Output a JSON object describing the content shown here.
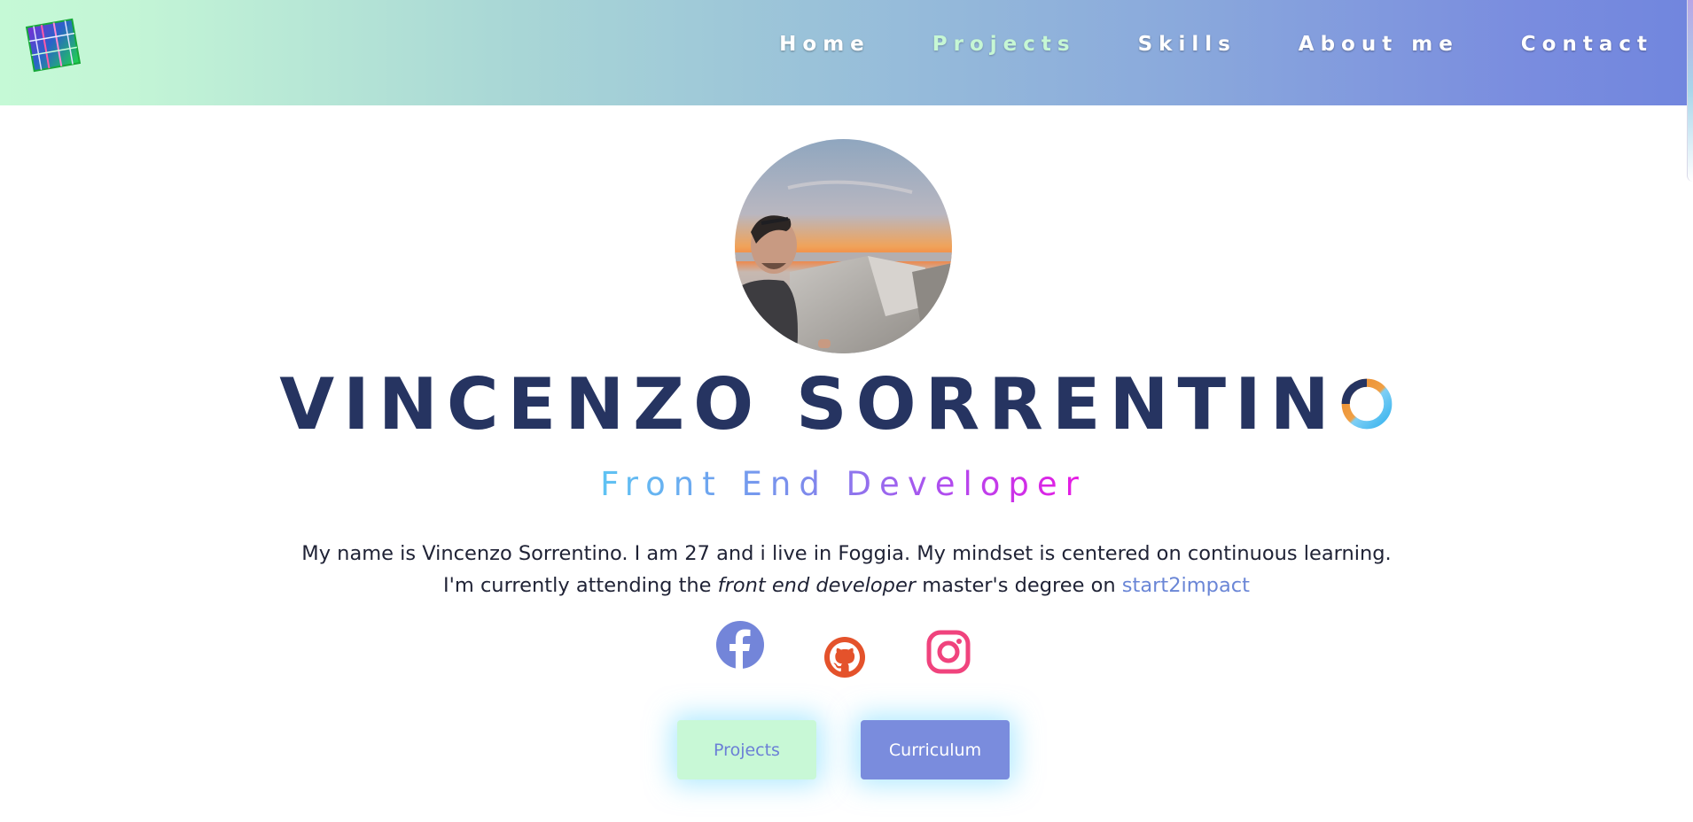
{
  "nav": {
    "items": [
      {
        "label": "Home",
        "active": false
      },
      {
        "label": "Projects",
        "active": true
      },
      {
        "label": "Skills",
        "active": false
      },
      {
        "label": "About me",
        "active": false
      },
      {
        "label": "Contact",
        "active": false
      }
    ]
  },
  "hero": {
    "name_main": "VINCENZO SORRENTIN",
    "name_last": "O",
    "role": "Front End Developer",
    "bio_line1": "My name is Vincenzo Sorrentino. I am 27 and i live in Foggia. My mindset is centered on continuous learning.",
    "bio_line2_prefix": "I'm currently attending the ",
    "bio_line2_em": "front end developer",
    "bio_line2_mid": " master's degree on ",
    "bio_line2_link": "start2impact"
  },
  "social": [
    {
      "icon": "facebook-icon",
      "color": "#7385d9"
    },
    {
      "icon": "github-icon",
      "color": "#e4522b"
    },
    {
      "icon": "instagram-icon",
      "color": "#f0437d"
    }
  ],
  "buttons": {
    "projects_label": "Projects",
    "cv_label": "Curriculum"
  },
  "colors": {
    "name": "#263461",
    "accent": "#7a8cdd",
    "mint": "#c8f8d6"
  }
}
